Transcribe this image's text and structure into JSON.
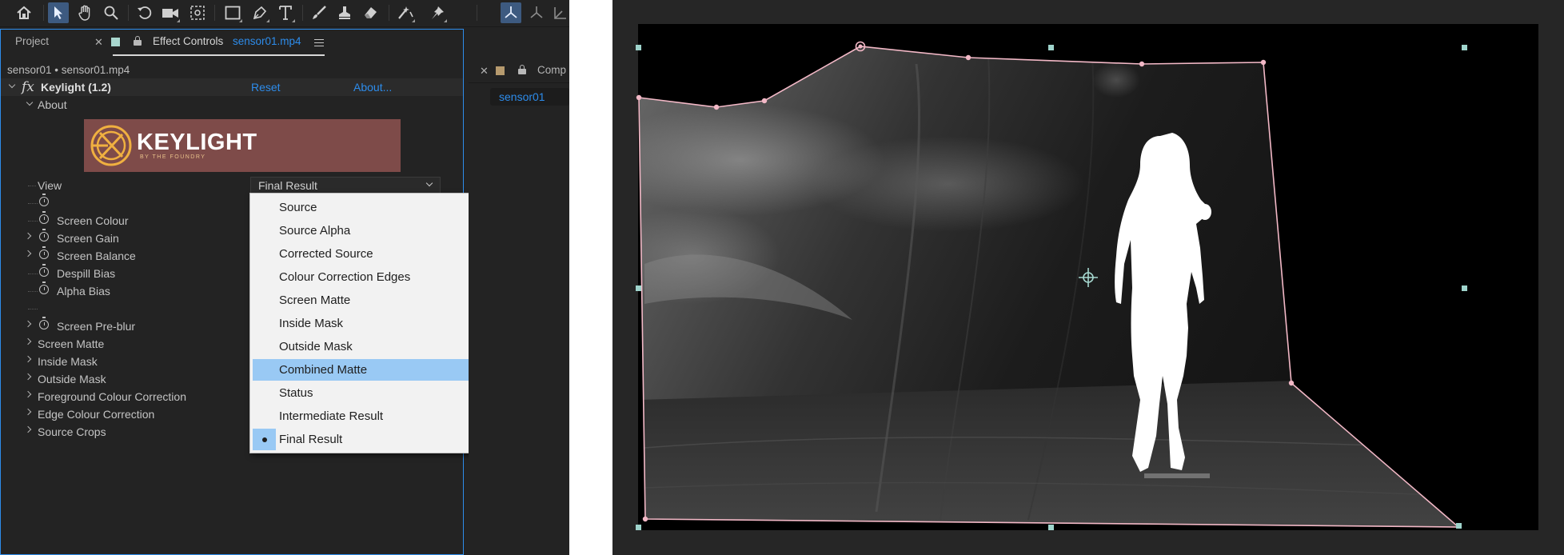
{
  "toolbar": {
    "tools": [
      "home-icon",
      "selection-tool-icon",
      "hand-tool-icon",
      "zoom-tool-icon",
      "rotate-tool-icon",
      "camera-tool-icon",
      "pan-behind-tool-icon",
      "rectangle-tool-icon",
      "pen-tool-icon",
      "type-tool-icon",
      "brush-tool-icon",
      "clone-stamp-tool-icon",
      "eraser-tool-icon",
      "roto-brush-tool-icon",
      "puppet-pin-tool-icon"
    ],
    "active_tool": "selection-tool-icon"
  },
  "panel": {
    "tabs": {
      "project": "Project",
      "effect_controls": "Effect Controls",
      "effect_controls_file": "sensor01.mp4"
    },
    "breadcrumb": "sensor01 • sensor01.mp4",
    "effect": {
      "name": "Keylight (1.2)",
      "reset": "Reset",
      "about": "About...",
      "about_section": "About",
      "logo_text": "KEYLIGHT",
      "logo_subtext": "BY THE FOUNDRY"
    },
    "properties": {
      "view_label": "View",
      "view_value": "Final Result",
      "screen_colour": "Screen Colour",
      "screen_gain": "Screen Gain",
      "screen_balance": "Screen Balance",
      "despill_bias": "Despill Bias",
      "alpha_bias": "Alpha Bias",
      "screen_preblur": "Screen Pre-blur",
      "screen_matte": "Screen Matte",
      "inside_mask": "Inside Mask",
      "outside_mask": "Outside Mask",
      "foreground_cc": "Foreground Colour Correction",
      "edge_cc": "Edge Colour Correction",
      "source_crops": "Source Crops"
    },
    "dropdown": {
      "options": [
        "Source",
        "Source Alpha",
        "Corrected Source",
        "Colour Correction Edges",
        "Screen Matte",
        "Inside Mask",
        "Outside Mask",
        "Combined Matte",
        "Status",
        "Intermediate Result",
        "Final Result"
      ],
      "highlighted": "Combined Matte",
      "selected": "Final Result"
    }
  },
  "composition": {
    "tab_label": "Comp",
    "chip_label": "sensor01"
  },
  "colors": {
    "accent": "#2d8ceb",
    "dropdown_highlight": "#99c9f4",
    "mask_path": "#f2b8c6",
    "panel_bg": "#232323"
  }
}
